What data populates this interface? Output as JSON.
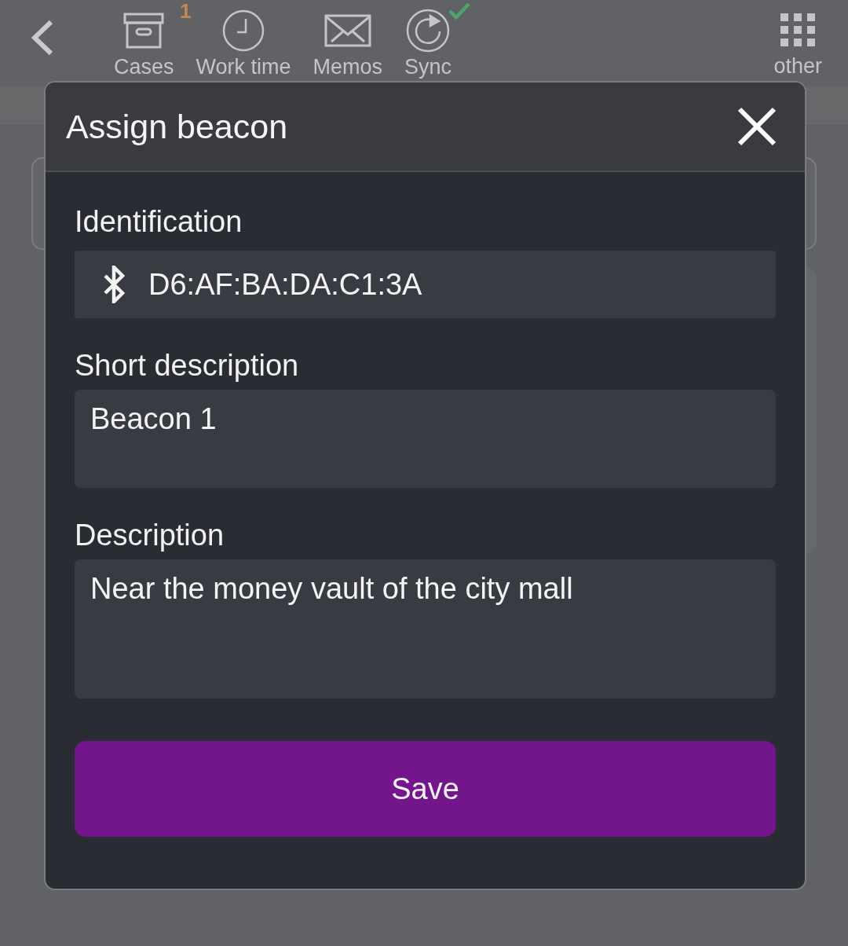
{
  "toolbar": {
    "items": [
      {
        "label": "Cases",
        "badge": "1"
      },
      {
        "label": "Work time"
      },
      {
        "label": "Memos"
      },
      {
        "label": "Sync",
        "synced": true
      }
    ],
    "other": {
      "label": "other"
    }
  },
  "dialog": {
    "title": "Assign beacon",
    "fields": [
      {
        "kind": "readonly",
        "label": "Identification",
        "value": "D6:AF:BA:DA:C1:3A"
      },
      {
        "kind": "text",
        "label": "Short description",
        "value": "Beacon 1"
      },
      {
        "kind": "textarea",
        "label": "Description",
        "value": "Near the money vault of the city mall"
      }
    ],
    "save_button": "Save"
  }
}
